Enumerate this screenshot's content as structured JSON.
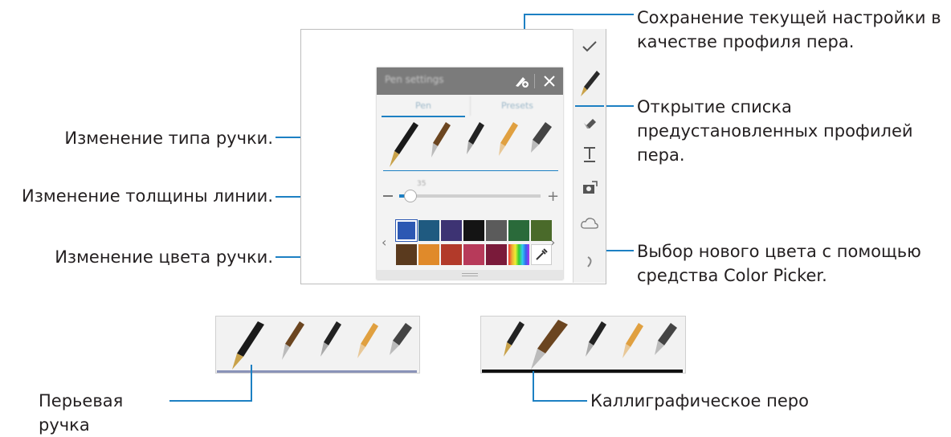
{
  "callouts": {
    "save_profile": "Сохранение текущей настройки в качестве профиля пера.",
    "presets": "Открытие списка предустановленных профилей пера.",
    "pen_type": "Изменение типа ручки.",
    "thickness": "Изменение толщины линии.",
    "color": "Изменение цвета ручки.",
    "color_picker": "Выбор нового цвета с помощью средства Color Picker."
  },
  "panel": {
    "title": "Pen settings",
    "tabs": [
      "Pen",
      "Presets"
    ],
    "size_value": "35"
  },
  "colors": {
    "row1": [
      "#2c58b3",
      "#1f5a80",
      "#3d3373",
      "#141414",
      "#5b5b5b",
      "#2a6a3a",
      "#4a6a2a"
    ],
    "row2": [
      "#5a3a1e",
      "#e08a2a",
      "#b23a2a",
      "#b73a5a",
      "#7a1a3a",
      "spectrum",
      "picker"
    ],
    "accent": "#1d80c3"
  },
  "pens_bottom": {
    "fountain_label": "Перьевая ручка",
    "calligraphy_label": "Каллиграфическое перо"
  }
}
